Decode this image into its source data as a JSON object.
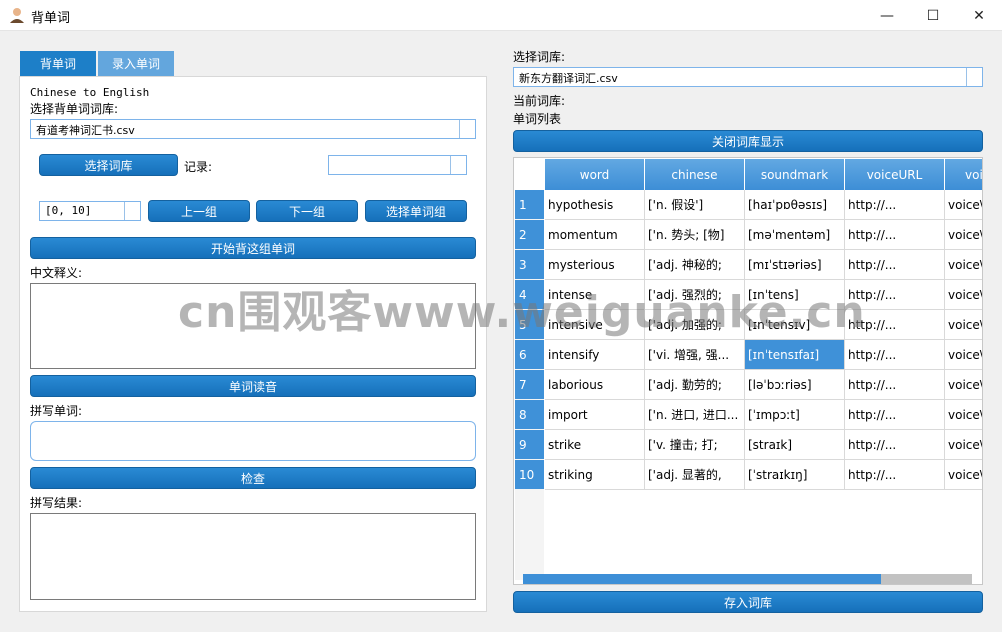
{
  "window": {
    "title": "背单词",
    "minimize_glyph": "—",
    "maximize_glyph": "☐",
    "close_glyph": "✕"
  },
  "tabs": [
    {
      "label": "背单词",
      "active": true
    },
    {
      "label": "录入单词",
      "active": false
    }
  ],
  "left": {
    "direction": "Chinese to English",
    "choose_lib_label": "选择背单词词库:",
    "lib_value": "有道考神词汇书.csv",
    "choose_lib_button": "选择词库",
    "record_label": "记录:",
    "record_value": "",
    "range_value": "[0, 10]",
    "prev_group_button": "上一组",
    "next_group_button": "下一组",
    "select_group_button": "选择单词组",
    "start_button": "开始背这组单词",
    "meaning_label": "中文释义:",
    "pronounce_button": "单词读音",
    "spell_label": "拼写单词:",
    "check_button": "检查",
    "result_label": "拼写结果:"
  },
  "right": {
    "choose_lib_label": "选择词库:",
    "lib_value": "新东方翻译词汇.csv",
    "current_lib_label": "当前词库:",
    "word_list_label": "单词列表",
    "close_display_button": "关闭词库显示",
    "save_button": "存入词库",
    "table": {
      "columns": [
        "word",
        "chinese",
        "soundmark",
        "voiceURL",
        "voi"
      ],
      "rows": [
        {
          "n": "1",
          "cells": [
            "hypothesis",
            "['n. 假设']",
            "[haɪˈpɒθəsɪs]",
            "http://...",
            "voice\\"
          ]
        },
        {
          "n": "2",
          "cells": [
            "momentum",
            "['n. 势头; [物]",
            "[məˈmentəm]",
            "http://...",
            "voice\\"
          ]
        },
        {
          "n": "3",
          "cells": [
            "mysterious",
            "['adj. 神秘的;",
            "[mɪˈstɪəriəs]",
            "http://...",
            "voice\\"
          ]
        },
        {
          "n": "4",
          "cells": [
            "intense",
            "['adj. 强烈的;",
            "[ɪnˈtens]",
            "http://...",
            "voice\\"
          ]
        },
        {
          "n": "5",
          "cells": [
            "intensive",
            "['adj. 加强的;",
            "[ɪnˈtensɪv]",
            "http://...",
            "voice\\"
          ]
        },
        {
          "n": "6",
          "cells": [
            "intensify",
            "['vi. 增强, 强...",
            "[ɪnˈtensɪfaɪ]",
            "http://...",
            "voice\\"
          ]
        },
        {
          "n": "7",
          "cells": [
            "laborious",
            "['adj. 勤劳的;",
            "[ləˈbɔːriəs]",
            "http://...",
            "voice\\"
          ]
        },
        {
          "n": "8",
          "cells": [
            "import",
            "['n. 进口, 进口...",
            "[ˈɪmpɔːt]",
            "http://...",
            "voice\\"
          ]
        },
        {
          "n": "9",
          "cells": [
            "strike",
            "['v. 撞击; 打;",
            "[straɪk]",
            "http://...",
            "voice\\"
          ]
        },
        {
          "n": "10",
          "cells": [
            "striking",
            "['adj. 显著的,",
            "[ˈstraɪkɪŋ]",
            "http://...",
            "voice\\"
          ]
        }
      ],
      "selected": {
        "row": 5,
        "col": 2
      }
    }
  },
  "watermark": "cn围观客www.weiguanke.cn",
  "colors": {
    "accent": "#1d7fc8",
    "header": "#3d8ed6"
  }
}
